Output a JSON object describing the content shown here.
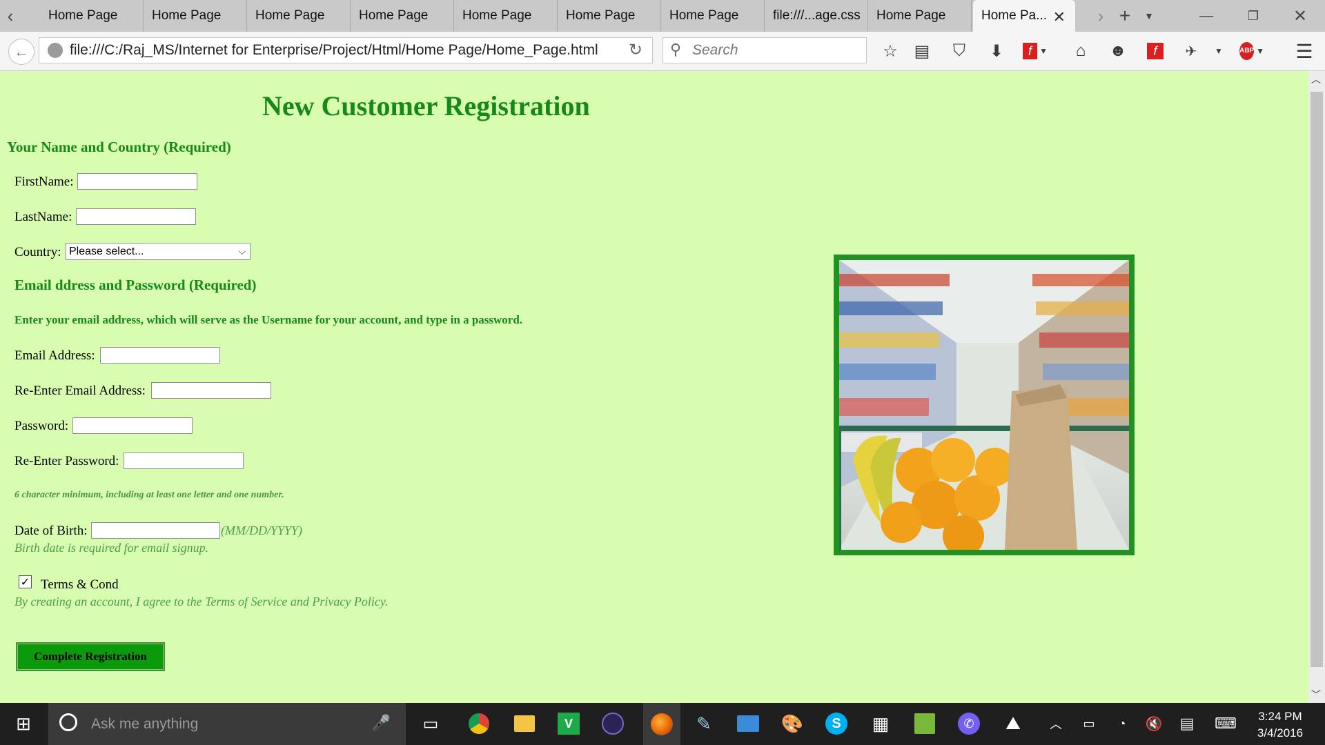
{
  "browser": {
    "tabs": [
      {
        "label": "Home Page"
      },
      {
        "label": "Home Page"
      },
      {
        "label": "Home Page"
      },
      {
        "label": "Home Page"
      },
      {
        "label": "Home Page"
      },
      {
        "label": "Home Page"
      },
      {
        "label": "Home Page"
      },
      {
        "label": "file:///...age.css"
      },
      {
        "label": "Home Page"
      },
      {
        "label": "Home Pa..."
      }
    ],
    "url": "file:///C:/Raj_MS/Internet for Enterprise/Project/Html/Home Page/Home_Page.html",
    "search_placeholder": "Search"
  },
  "page": {
    "title": "New Customer Registration",
    "section1_heading": "Your Name and Country (Required)",
    "firstname_label": "FirstName:",
    "lastname_label": "LastName:",
    "country_label": "Country:",
    "country_selected": "Please select...",
    "section2_heading": "Email ddress and Password (Required)",
    "section2_instruction": "Enter your email address, which will serve as the Username for your account, and type in a password.",
    "email_label": "Email Address:",
    "reemail_label": "Re-Enter Email Address:",
    "password_label": "Password:",
    "repassword_label": "Re-Enter Password:",
    "password_hint": "6 character minimum, including at least one letter and one number.",
    "dob_label": "Date of Birth:",
    "dob_format": "(MM/DD/YYYY)",
    "dob_note": "Birth date is required for email signup.",
    "terms_label": "Terms & Cond",
    "terms_checked": true,
    "terms_note": "By creating an account, I agree to the Terms of Service and Privacy Policy.",
    "submit_label": "Complete Registration"
  },
  "colors": {
    "page_background": "#d8fcb0",
    "heading_green": "#168916",
    "button_green": "#0a9a0a"
  },
  "taskbar": {
    "search_placeholder": "Ask me anything",
    "time": "3:24 PM",
    "date": "3/4/2016"
  }
}
